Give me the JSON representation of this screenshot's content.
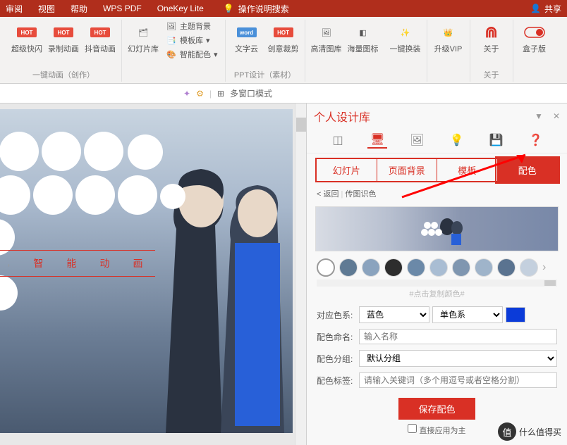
{
  "topmenu": [
    "审阅",
    "视图",
    "帮助",
    "WPS PDF",
    "OneKey Lite"
  ],
  "search_hint": "操作说明搜索",
  "share": "共享",
  "ribbon": {
    "group1": {
      "btns": [
        "超级快闪",
        "录制动画",
        "抖音动画"
      ],
      "label": "一键动画（创作）"
    },
    "group2": {
      "btn": "幻灯片库",
      "stack": [
        "主题背景",
        "模板库",
        "智能配色"
      ]
    },
    "group3": {
      "btns": [
        "文字云",
        "创意裁剪"
      ],
      "label": "PPT设计（素材）"
    },
    "group4": {
      "btns": [
        "高清图库",
        "海量图标"
      ]
    },
    "group5": {
      "btn": "一键换装"
    },
    "group6": {
      "btn": "升级VIP"
    },
    "group7": {
      "btn": "关于",
      "label": "关于"
    },
    "group8": {
      "btn": "盒子版"
    }
  },
  "subbar": {
    "multiwindow": "多窗口模式"
  },
  "slide": {
    "text_chars": [
      "智",
      "能",
      "动",
      "画"
    ]
  },
  "panel": {
    "title": "个人设计库",
    "tabs": [
      "幻灯片",
      "页面背景",
      "模板",
      "配色"
    ],
    "back": "< 返回",
    "back_sub": "传图识色",
    "swatch_hint": "#点击复制颜色#",
    "form": {
      "colorsys_lbl": "对应色系:",
      "colorsys_val": "蓝色",
      "colortype_val": "单色系",
      "name_lbl": "配色命名:",
      "name_ph": "输入名称",
      "group_lbl": "配色分组:",
      "group_val": "默认分组",
      "tag_lbl": "配色标签:",
      "tag_ph": "请输入关键词（多个用逗号或者空格分割）"
    },
    "save": "保存配色",
    "apply": "直接应用为主"
  },
  "swatches": [
    "#ffffff",
    "#5f7a94",
    "#8aa3be",
    "#2d2d2d",
    "#6b89a8",
    "#a9bdd3",
    "#7f96b0",
    "#9fb4ca",
    "#5a7390",
    "#c4d0de"
  ],
  "color_preview": "#0b3bd9",
  "watermark": {
    "icon": "值",
    "text": "什么值得买"
  }
}
